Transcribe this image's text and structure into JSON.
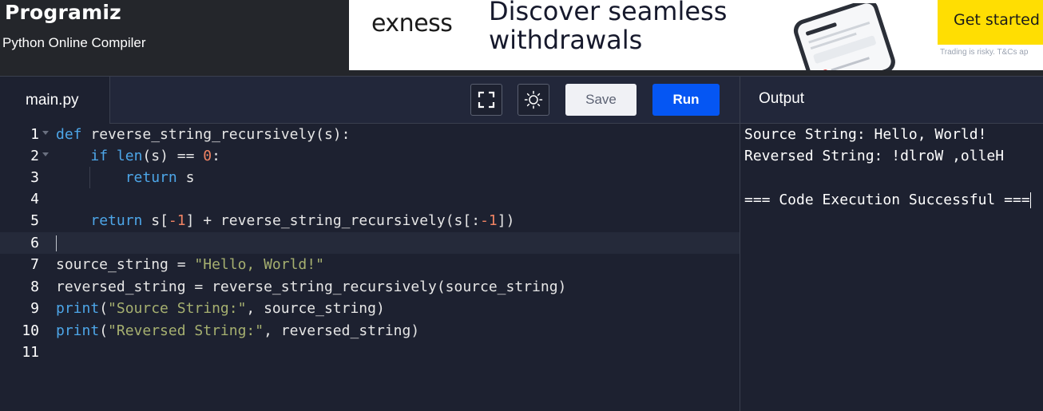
{
  "header": {
    "logo": "Programiz",
    "subtitle": "Python Online Compiler"
  },
  "ad": {
    "brand": "exness",
    "headline": "Discover seamless withdrawals",
    "cta": "Get started",
    "disclaimer": "Trading is risky. T&Cs ap"
  },
  "editor": {
    "tab_label": "main.py",
    "save_label": "Save",
    "run_label": "Run",
    "fullscreen_icon": "fullscreen-icon",
    "theme_icon": "sun-icon",
    "lines": [
      {
        "n": "1",
        "text": "def reverse_string_recursively(s):"
      },
      {
        "n": "2",
        "text": "    if len(s) == 0:"
      },
      {
        "n": "3",
        "text": "        return s"
      },
      {
        "n": "4",
        "text": ""
      },
      {
        "n": "5",
        "text": "    return s[-1] + reverse_string_recursively(s[:-1])"
      },
      {
        "n": "6",
        "text": ""
      },
      {
        "n": "7",
        "text": "source_string = \"Hello, World!\""
      },
      {
        "n": "8",
        "text": "reversed_string = reverse_string_recursively(source_string)"
      },
      {
        "n": "9",
        "text": "print(\"Source String:\", source_string)"
      },
      {
        "n": "10",
        "text": "print(\"Reversed String:\", reversed_string)"
      },
      {
        "n": "11",
        "text": ""
      }
    ]
  },
  "output": {
    "header": "Output",
    "lines": [
      "Source String: Hello, World!",
      "Reversed String: !dlroW ,olleH",
      "",
      "=== Code Execution Successful ==="
    ]
  },
  "colors": {
    "run_button": "#0556f3",
    "ad_cta": "#ffde02",
    "editor_bg": "#1d2130",
    "keyword": "#4da6e8",
    "number": "#f08363",
    "string": "#a6b070"
  }
}
